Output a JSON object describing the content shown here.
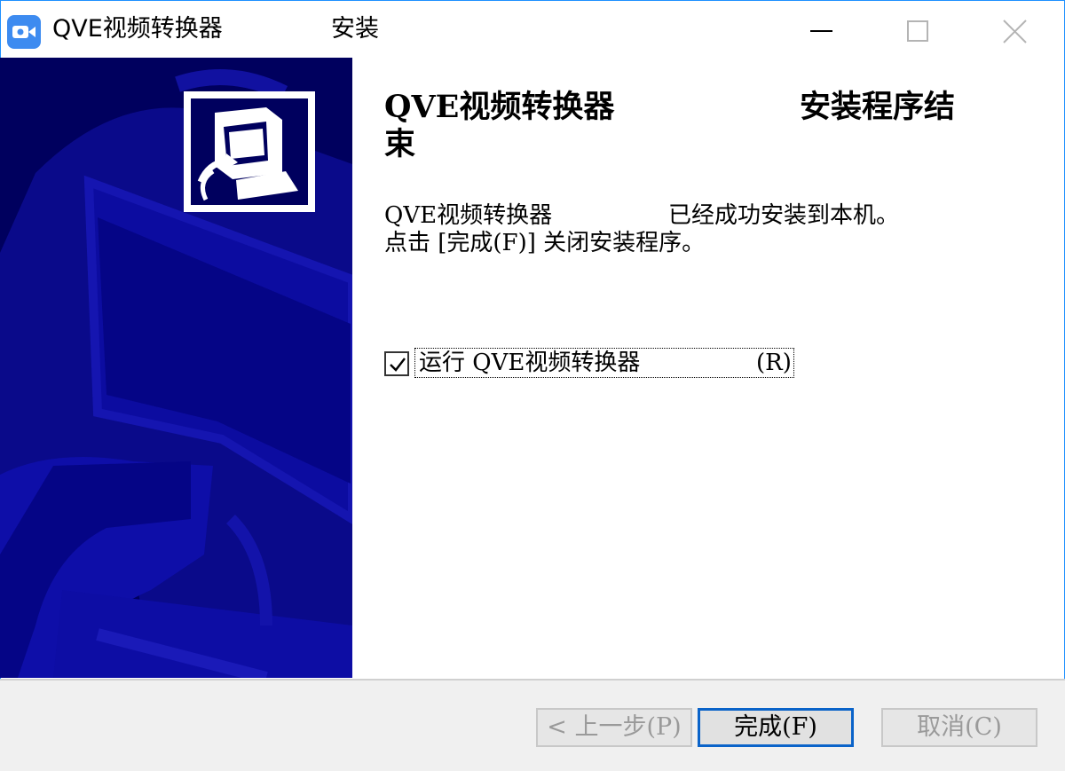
{
  "window": {
    "title": "QVE视频转换器",
    "title_suffix": "安装",
    "accent_color": "#3d8bf0",
    "icons": [
      "video-camera-icon",
      "minimize-icon",
      "maximize-icon",
      "close-icon"
    ]
  },
  "banner": {
    "background_color": "#00005e",
    "logo_icon": "installer-computer-icon"
  },
  "content": {
    "heading_name": "QVE视频转换器",
    "heading_rest_line1": "安装程序结",
    "heading_rest_line2": "束",
    "desc_line1_name": "QVE视频转换器",
    "desc_line1_rest": "已经成功安装到本机。",
    "desc_line2": "点击 [完成(F)] 关闭安装程序。",
    "run_checkbox": {
      "label": "运行 QVE视频转换器",
      "shortcut": "(R)",
      "checked": true
    }
  },
  "footer": {
    "back_label": "< 上一步(P)",
    "finish_label": "完成(F)",
    "cancel_label": "取消(C)"
  }
}
